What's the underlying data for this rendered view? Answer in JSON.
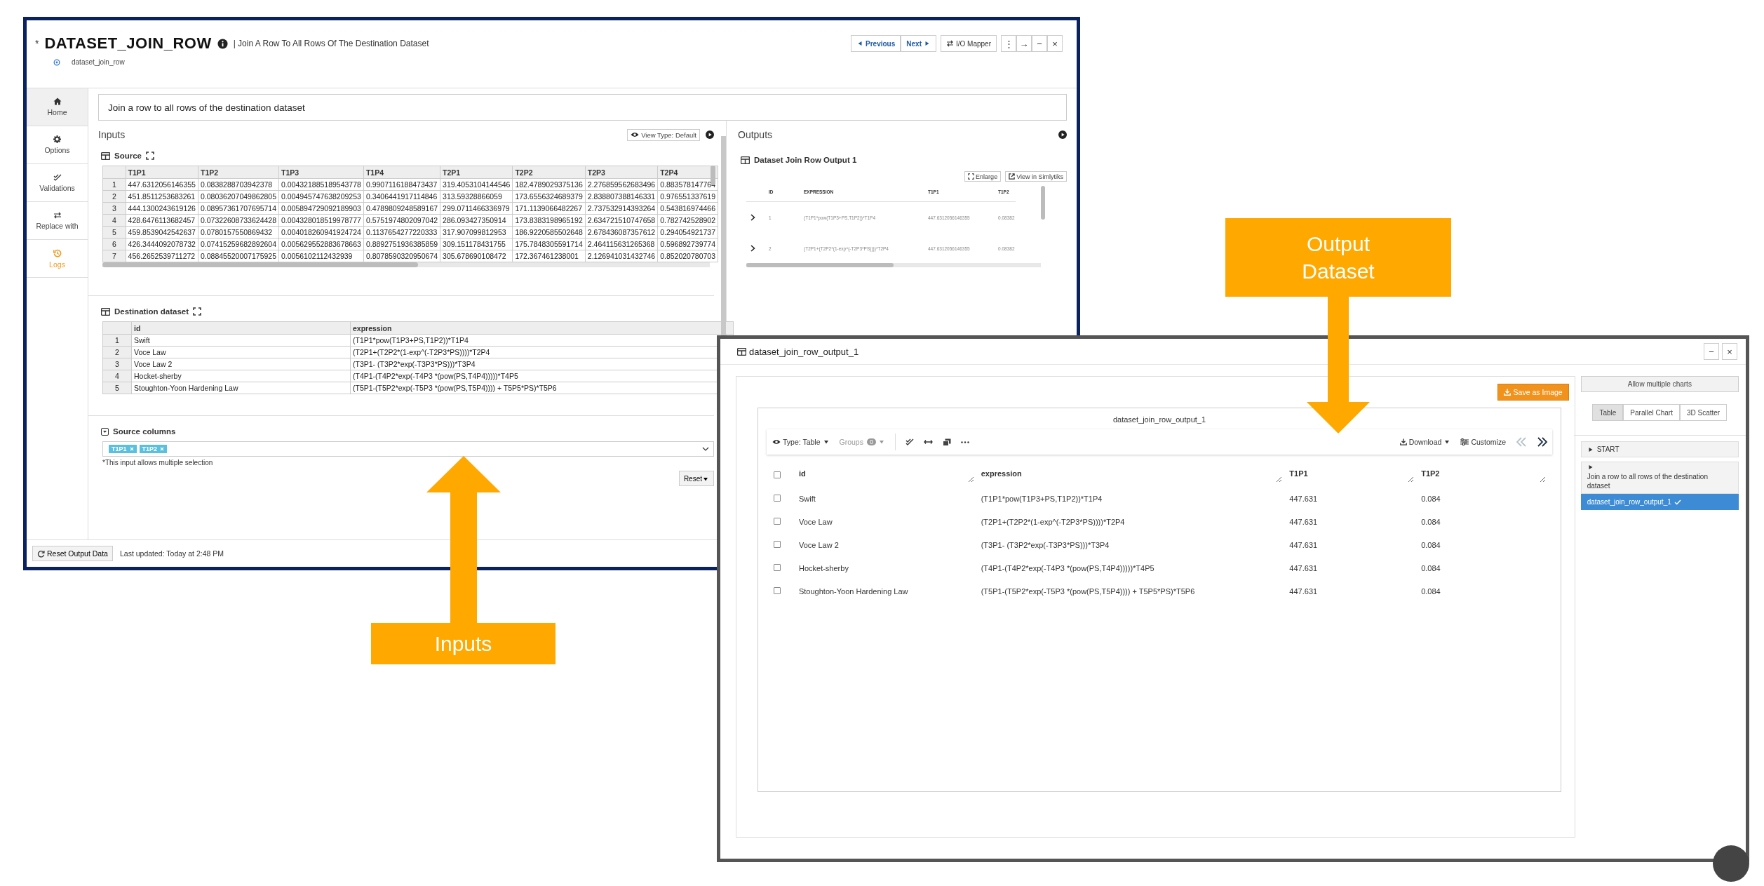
{
  "main_window": {
    "modified_mark": "*",
    "title": "DATASET_JOIN_ROW",
    "subtitle": "| Join A Row To All Rows Of The Destination Dataset",
    "node_name": "dataset_join_row",
    "nav_buttons": [
      {
        "label": "Previous",
        "kind": "prev"
      },
      {
        "label": "Next",
        "kind": "next"
      }
    ],
    "io_mapper": "I/O Mapper",
    "window_buttons": [
      "⋮",
      "→",
      "−",
      "×"
    ],
    "sidebar": [
      {
        "label": "Home",
        "kind": "home",
        "selected": true
      },
      {
        "label": "Options",
        "kind": "options",
        "selected": false
      },
      {
        "label": "Validations",
        "kind": "validations",
        "selected": false
      },
      {
        "label": "Replace with",
        "kind": "replace",
        "selected": false
      },
      {
        "label": "Logs",
        "kind": "logs",
        "selected": false
      }
    ],
    "description": "Join a row to all rows of the destination dataset",
    "inputs": {
      "heading": "Inputs",
      "view_type": "View Type: Default",
      "source": {
        "title": "Source",
        "columns": [
          "T1P1",
          "T1P2",
          "T1P3",
          "T1P4",
          "T2P1",
          "T2P2",
          "T2P3",
          "T2P4"
        ],
        "rows": [
          {
            "index": "1",
            "cells": [
              "447.6312056146355",
              "0.0838288703942378",
              "0.004321885189543778",
              "0.9907116188473437",
              "319.4053104144546",
              "182.4789029375136",
              "2.276859562683496",
              "0.883578147764"
            ]
          },
          {
            "index": "2",
            "cells": [
              "451.8511253683261",
              "0.08036207049862805",
              "0.004945747638209253",
              "0.3406441917114846",
              "313.59328866059",
              "173.6556324689379",
              "2.838807388146331",
              "0.976551337619"
            ]
          },
          {
            "index": "3",
            "cells": [
              "444.1300243619126",
              "0.08957361707695714",
              "0.005894729092189903",
              "0.4789809248589167",
              "299.0711466336979",
              "171.1139066482267",
              "2.737532914393264",
              "0.543816974466"
            ]
          },
          {
            "index": "4",
            "cells": [
              "428.6476113682457",
              "0.07322608733624428",
              "0.004328018519978777",
              "0.5751974802097042",
              "286.093427350914",
              "173.8383198965192",
              "2.634721510747658",
              "0.782742528902"
            ]
          },
          {
            "index": "5",
            "cells": [
              "459.8539042542637",
              "0.0780157550869432",
              "0.004018260941924724",
              "0.1137654277220333",
              "317.907099812953",
              "186.9220585502648",
              "2.678436087357612",
              "0.294054921737"
            ]
          },
          {
            "index": "6",
            "cells": [
              "426.3444092078732",
              "0.07415259682892604",
              "0.005629552883678663",
              "0.8892751936385859",
              "309.151178431755",
              "175.7848305591714",
              "2.464115631265368",
              "0.596892739774"
            ]
          },
          {
            "index": "7",
            "cells": [
              "456.2652539711272",
              "0.08845520007175925",
              "0.0056102112432939",
              "0.8078590320950674",
              "305.678690108472",
              "172.367461238001",
              "2.126941031432746",
              "0.852020780703"
            ]
          }
        ]
      },
      "destination": {
        "title": "Destination dataset",
        "columns": [
          "id",
          "expression"
        ],
        "rows": [
          {
            "index": "1",
            "cells": [
              "Swift",
              "(T1P1*pow(T1P3+PS,T1P2))*T1P4"
            ]
          },
          {
            "index": "2",
            "cells": [
              "Voce Law",
              "(T2P1+(T2P2*(1-exp^(-T2P3*PS))))*T2P4"
            ]
          },
          {
            "index": "3",
            "cells": [
              "Voce Law 2",
              "(T3P1- (T3P2*exp(-T3P3*PS)))*T3P4"
            ]
          },
          {
            "index": "4",
            "cells": [
              "Hocket-sherby",
              "(T4P1-(T4P2*exp(-T4P3 *(pow(PS,T4P4)))))*T4P5"
            ]
          },
          {
            "index": "5",
            "cells": [
              "Stoughton-Yoon Hardening Law",
              "(T5P1-(T5P2*exp(-T5P3 *(pow(PS,T5P4)))) + T5P5*PS)*T5P6"
            ]
          }
        ]
      },
      "source_columns": {
        "title": "Source columns",
        "tags": [
          "T1P1",
          "T1P2"
        ],
        "hint": "*This input allows multiple selection",
        "reset": "Reset"
      }
    },
    "outputs": {
      "heading": "Outputs",
      "table_title": "Dataset Join Row Output 1",
      "enlarge": "Enlarge",
      "view_in": "View in Simlytiks",
      "columns": [
        "ID",
        "EXPRESSION",
        "T1P1",
        "T1P2"
      ],
      "rows": [
        {
          "cells": [
            "1",
            "(T1P1*pow(T1P3+PS,T1P2))*T1P4",
            "447.6312056146355",
            "0.08382"
          ]
        },
        {
          "cells": [
            "2",
            "(T2P1+(T2P2*(1-exp^(-T2P3*PS))))*T2P4",
            "447.6312056146355",
            "0.08382"
          ]
        }
      ]
    },
    "footer": {
      "reset_button": "Reset Output Data",
      "last_updated": "Last updated: Today at 2:48 PM"
    }
  },
  "dialog": {
    "title": "dataset_join_row_output_1",
    "window_buttons": [
      "−",
      "×"
    ],
    "save_image": "Save as Image",
    "chart_title": "dataset_join_row_output_1",
    "type": "Type: Table",
    "groups": "Groups",
    "groups_count": "0",
    "download": "Download",
    "customize": "Customize",
    "all_checked": false,
    "columns": [
      "id",
      "expression",
      "T1P1",
      "T1P2"
    ],
    "rows": [
      {
        "checked": false,
        "cells": [
          "Swift",
          "(T1P1*pow(T1P3+PS,T1P2))*T1P4",
          "447.631",
          "0.084"
        ]
      },
      {
        "checked": false,
        "cells": [
          "Voce Law",
          "(T2P1+(T2P2*(1-exp^(-T2P3*PS))))*T2P4",
          "447.631",
          "0.084"
        ]
      },
      {
        "checked": false,
        "cells": [
          "Voce Law 2",
          "(T3P1- (T3P2*exp(-T3P3*PS)))*T3P4",
          "447.631",
          "0.084"
        ]
      },
      {
        "checked": false,
        "cells": [
          "Hocket-sherby",
          "(T4P1-(T4P2*exp(-T4P3 *(pow(PS,T4P4)))))*T4P5",
          "447.631",
          "0.084"
        ]
      },
      {
        "checked": false,
        "cells": [
          "Stoughton-Yoon Hardening Law",
          "(T5P1-(T5P2*exp(-T5P3 *(pow(PS,T5P4)))) + T5P5*PS)*T5P6",
          "447.631",
          "0.084"
        ]
      }
    ],
    "side": {
      "allow_multiple": "Allow multiple charts",
      "views": [
        {
          "label": "Table",
          "selected": true
        },
        {
          "label": "Parallel Chart",
          "selected": false
        },
        {
          "label": "3D Scatter",
          "selected": false
        }
      ],
      "steps": [
        {
          "label": "START",
          "selected": false
        },
        {
          "label": "Join a row to all rows of the destination dataset",
          "selected": false
        },
        {
          "label": "dataset_join_row_output_1",
          "selected": true
        }
      ]
    }
  },
  "callouts": [
    {
      "label": "Output Dataset",
      "kind": "down"
    },
    {
      "label": "Inputs",
      "kind": "up"
    }
  ]
}
